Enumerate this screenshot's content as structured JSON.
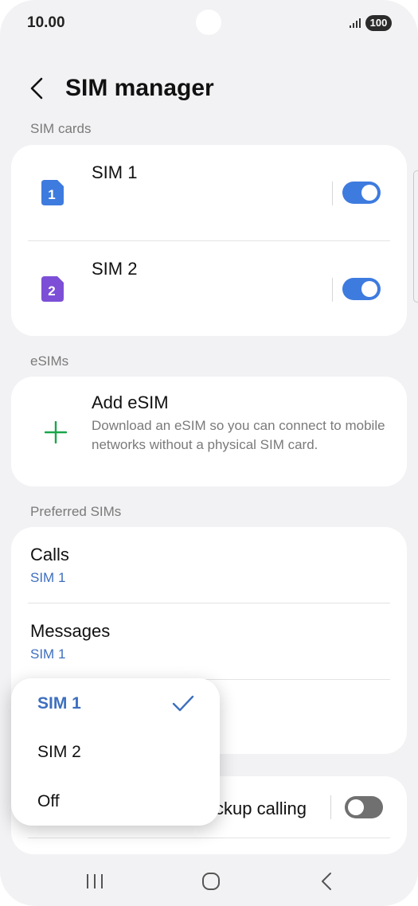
{
  "status_bar": {
    "time": "10.00",
    "battery": "100"
  },
  "header": {
    "title": "SIM manager"
  },
  "sim_cards": {
    "section_label": "SIM cards",
    "items": [
      {
        "name": "SIM 1",
        "badge": "1",
        "enabled": true,
        "color": "#3e7bdf"
      },
      {
        "name": "SIM 2",
        "badge": "2",
        "enabled": true,
        "color": "#7c4fd6"
      }
    ]
  },
  "esims": {
    "section_label": "eSIMs",
    "add_title": "Add eSIM",
    "add_description": "Download an eSIM so you can connect to mobile networks without a physical SIM card.",
    "plus_color": "#1aa64a"
  },
  "preferred_sims": {
    "section_label": "Preferred SIMs",
    "items": [
      {
        "label": "Calls",
        "value": "SIM 1"
      },
      {
        "label": "Messages",
        "value": "SIM 1"
      }
    ]
  },
  "backup_calling": {
    "label_visible": "ckup calling",
    "enabled": false
  },
  "dropdown": {
    "options": [
      {
        "label": "SIM 1",
        "selected": true
      },
      {
        "label": "SIM 2",
        "selected": false
      },
      {
        "label": "Off",
        "selected": false
      }
    ]
  },
  "colors": {
    "accent": "#3e7bdf",
    "background": "#f2f2f4"
  }
}
